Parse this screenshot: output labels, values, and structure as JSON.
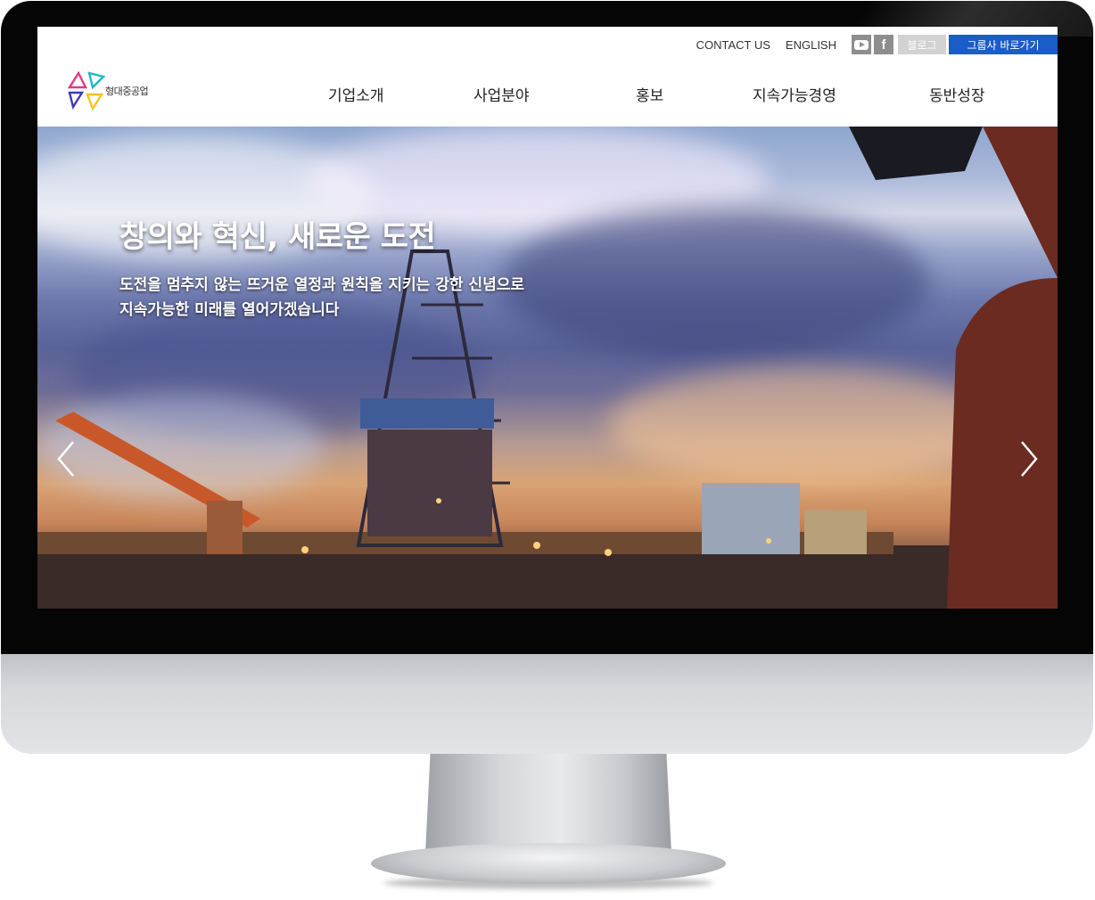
{
  "util": {
    "contact": "CONTACT US",
    "english": "ENGLISH",
    "facebook_glyph": "f",
    "blog": "블로그",
    "group_link": "그룹사 바로가기"
  },
  "logo": {
    "name": "형대중공업"
  },
  "nav": {
    "items": [
      "기업소개",
      "사업분야",
      "홍보",
      "지속가능경영",
      "동반성장"
    ]
  },
  "hero": {
    "title": "창의와 혁신, 새로운 도전",
    "subtitle_line1": "도전을 멈추지 않는 뜨거운 열정과 원칙을 지키는 강한 신념으로",
    "subtitle_line2": "지속가능한 미래를 열어가겠습니다"
  },
  "colors": {
    "accent": "#1a5cc8",
    "blog_button": "#d2d2d2",
    "sns_icon": "#8e8e8e"
  },
  "icons": [
    "youtube-icon",
    "facebook-icon",
    "chevron-left-icon",
    "chevron-right-icon"
  ]
}
